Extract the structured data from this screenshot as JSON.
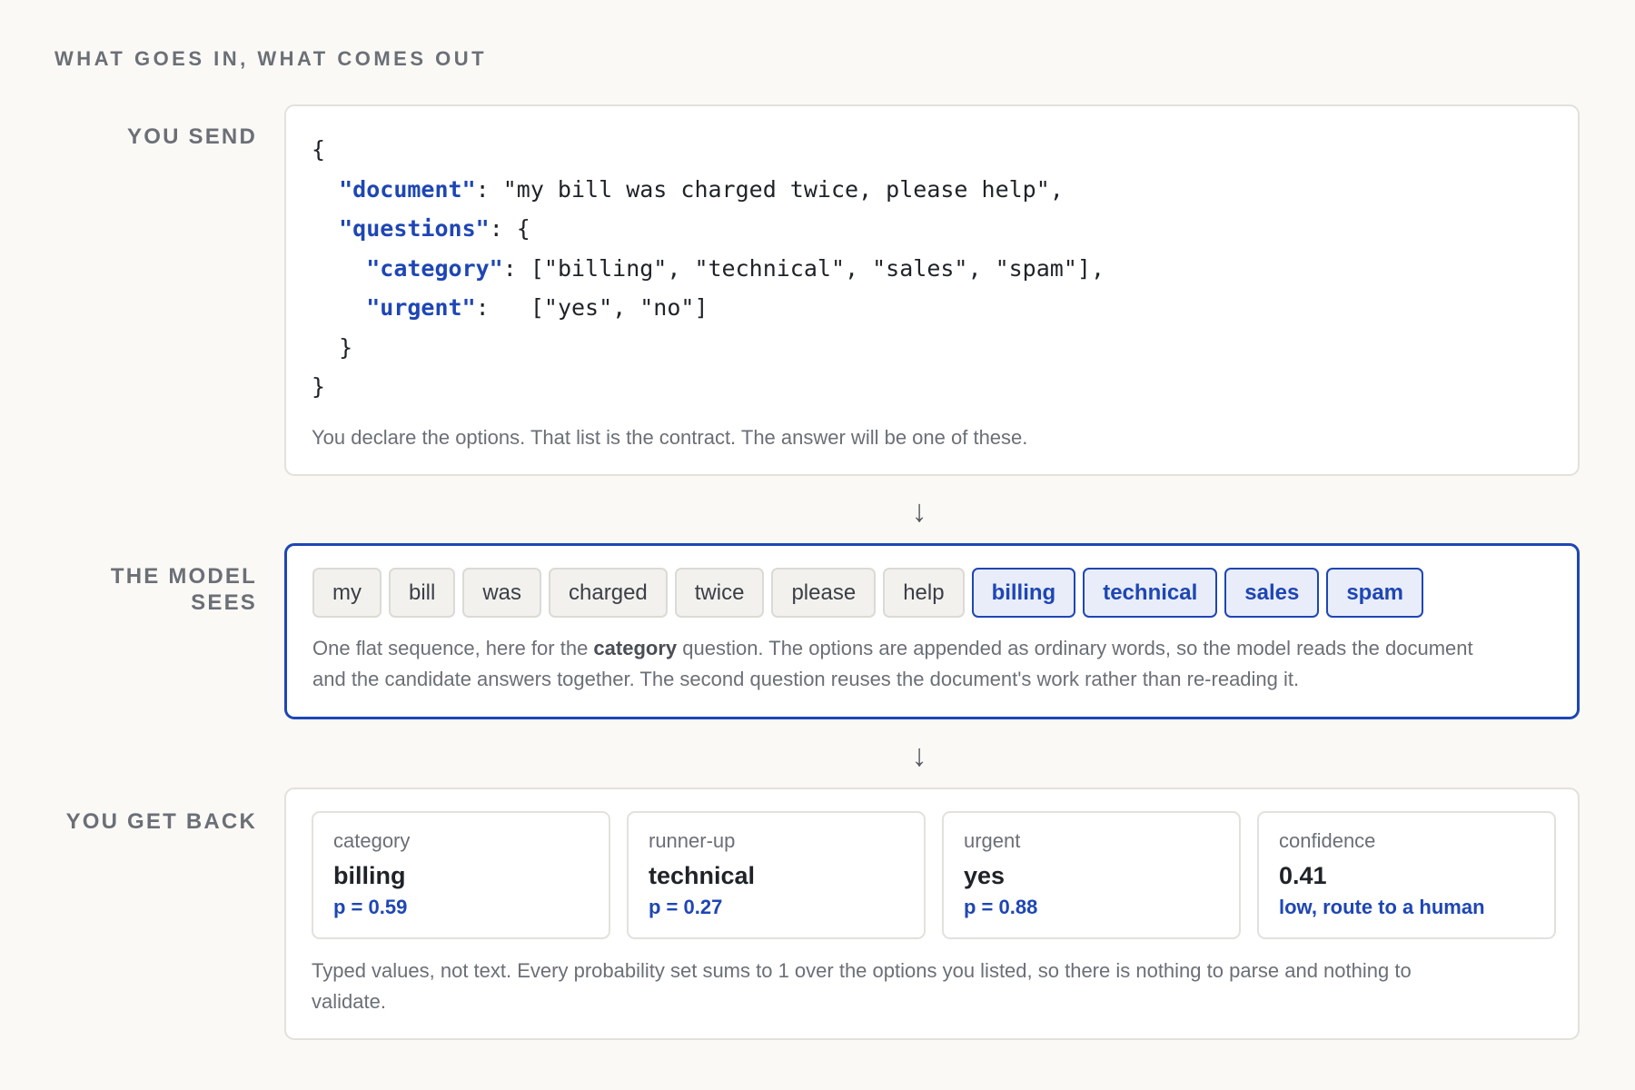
{
  "header": {
    "eyebrow": "WHAT GOES IN, WHAT COMES OUT"
  },
  "send": {
    "label": "YOU SEND",
    "code": {
      "open": "{",
      "document_key": "\"document\"",
      "document_rest": ": \"my bill was charged twice, please help\",",
      "questions_key": "\"questions\"",
      "questions_rest": ": {",
      "category_key": "\"category\"",
      "category_rest": ": [\"billing\", \"technical\", \"sales\", \"spam\"],",
      "urgent_key": "\"urgent\"",
      "urgent_rest": ":   [\"yes\", \"no\"]",
      "inner_close": "}",
      "close": "}"
    },
    "caption": "You declare the options. That list is the contract. The answer will be one of these."
  },
  "sees": {
    "label_line1": "THE MODEL",
    "label_line2": "SEES",
    "tokens": [
      "my",
      "bill",
      "was",
      "charged",
      "twice",
      "please",
      "help"
    ],
    "options": [
      "billing",
      "technical",
      "sales",
      "spam"
    ],
    "caption_before": "One flat sequence, here for the ",
    "caption_bold": "category",
    "caption_after": " question. The options are appended as ordinary words, so the model reads the document",
    "caption_line2": "and the candidate answers together. The second question reuses the document's work rather than re-reading it."
  },
  "back": {
    "label": "YOU GET BACK",
    "cards": [
      {
        "label": "category",
        "value": "billing",
        "sub": "p = 0.59"
      },
      {
        "label": "runner-up",
        "value": "technical",
        "sub": "p = 0.27"
      },
      {
        "label": "urgent",
        "value": "yes",
        "sub": "p = 0.88"
      },
      {
        "label": "confidence",
        "value": "0.41",
        "sub": "low, route to a human"
      }
    ],
    "caption_line1": "Typed values, not text. Every probability set sums to 1 over the options you listed, so there is nothing to parse and nothing to",
    "caption_line2": "validate."
  },
  "arrows": {
    "glyph": "↓"
  },
  "colors": {
    "accent": "#1e46b4",
    "muted": "#6b6f76",
    "background": "#faf9f6"
  }
}
